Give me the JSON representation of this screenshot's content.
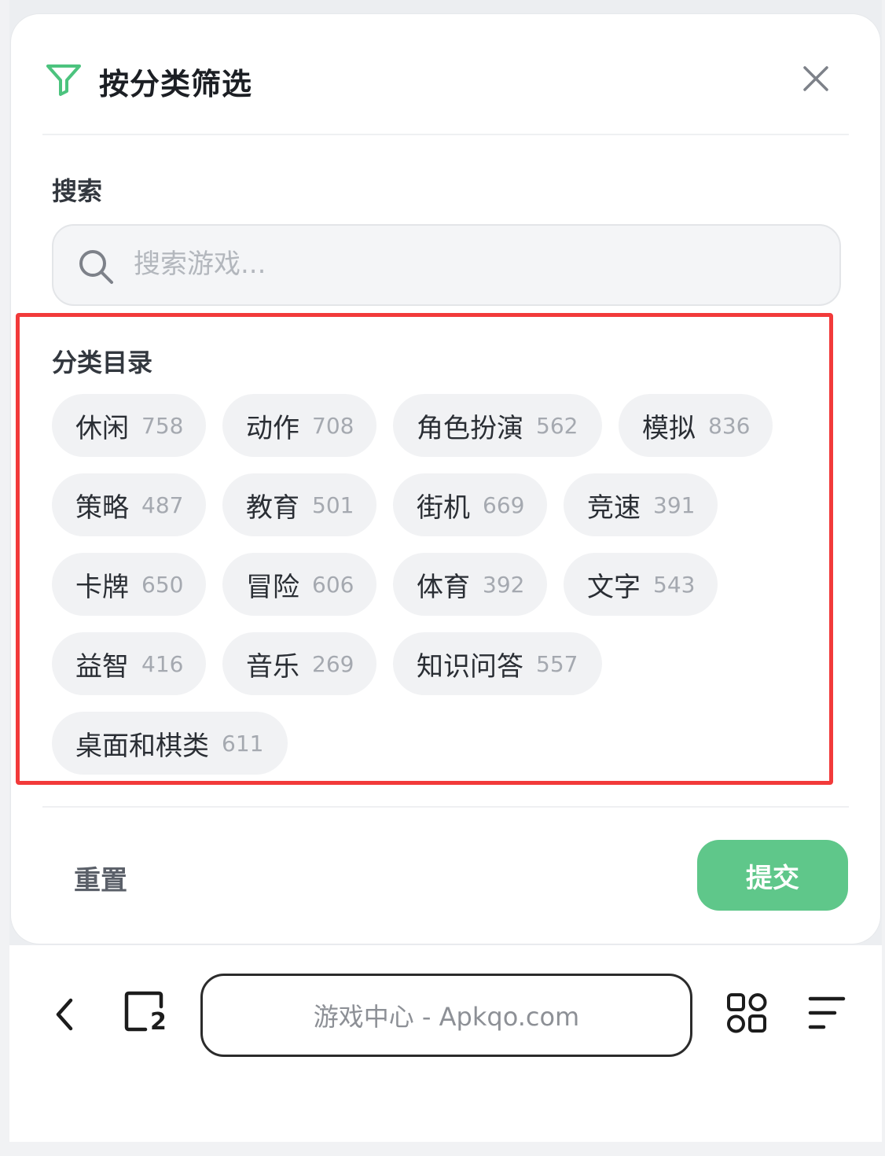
{
  "dialog": {
    "title": "按分类筛选",
    "accent_color": "#5fc78a"
  },
  "search": {
    "label": "搜索",
    "placeholder": "搜索游戏..."
  },
  "categories": {
    "label": "分类目录",
    "items": [
      {
        "name": "休闲",
        "count": "758"
      },
      {
        "name": "动作",
        "count": "708"
      },
      {
        "name": "角色扮演",
        "count": "562"
      },
      {
        "name": "模拟",
        "count": "836"
      },
      {
        "name": "策略",
        "count": "487"
      },
      {
        "name": "教育",
        "count": "501"
      },
      {
        "name": "街机",
        "count": "669"
      },
      {
        "name": "竞速",
        "count": "391"
      },
      {
        "name": "卡牌",
        "count": "650"
      },
      {
        "name": "冒险",
        "count": "606"
      },
      {
        "name": "体育",
        "count": "392"
      },
      {
        "name": "文字",
        "count": "543"
      },
      {
        "name": "益智",
        "count": "416"
      },
      {
        "name": "音乐",
        "count": "269"
      },
      {
        "name": "知识问答",
        "count": "557"
      },
      {
        "name": "桌面和棋类",
        "count": "611"
      }
    ]
  },
  "footer": {
    "reset_label": "重置",
    "submit_label": "提交"
  },
  "browser": {
    "url_text": "游戏中心 - Apkqo.com",
    "tab_count": "2",
    "icons": [
      "back-icon",
      "tabs-icon",
      "apps-grid-icon",
      "menu-icon"
    ]
  }
}
